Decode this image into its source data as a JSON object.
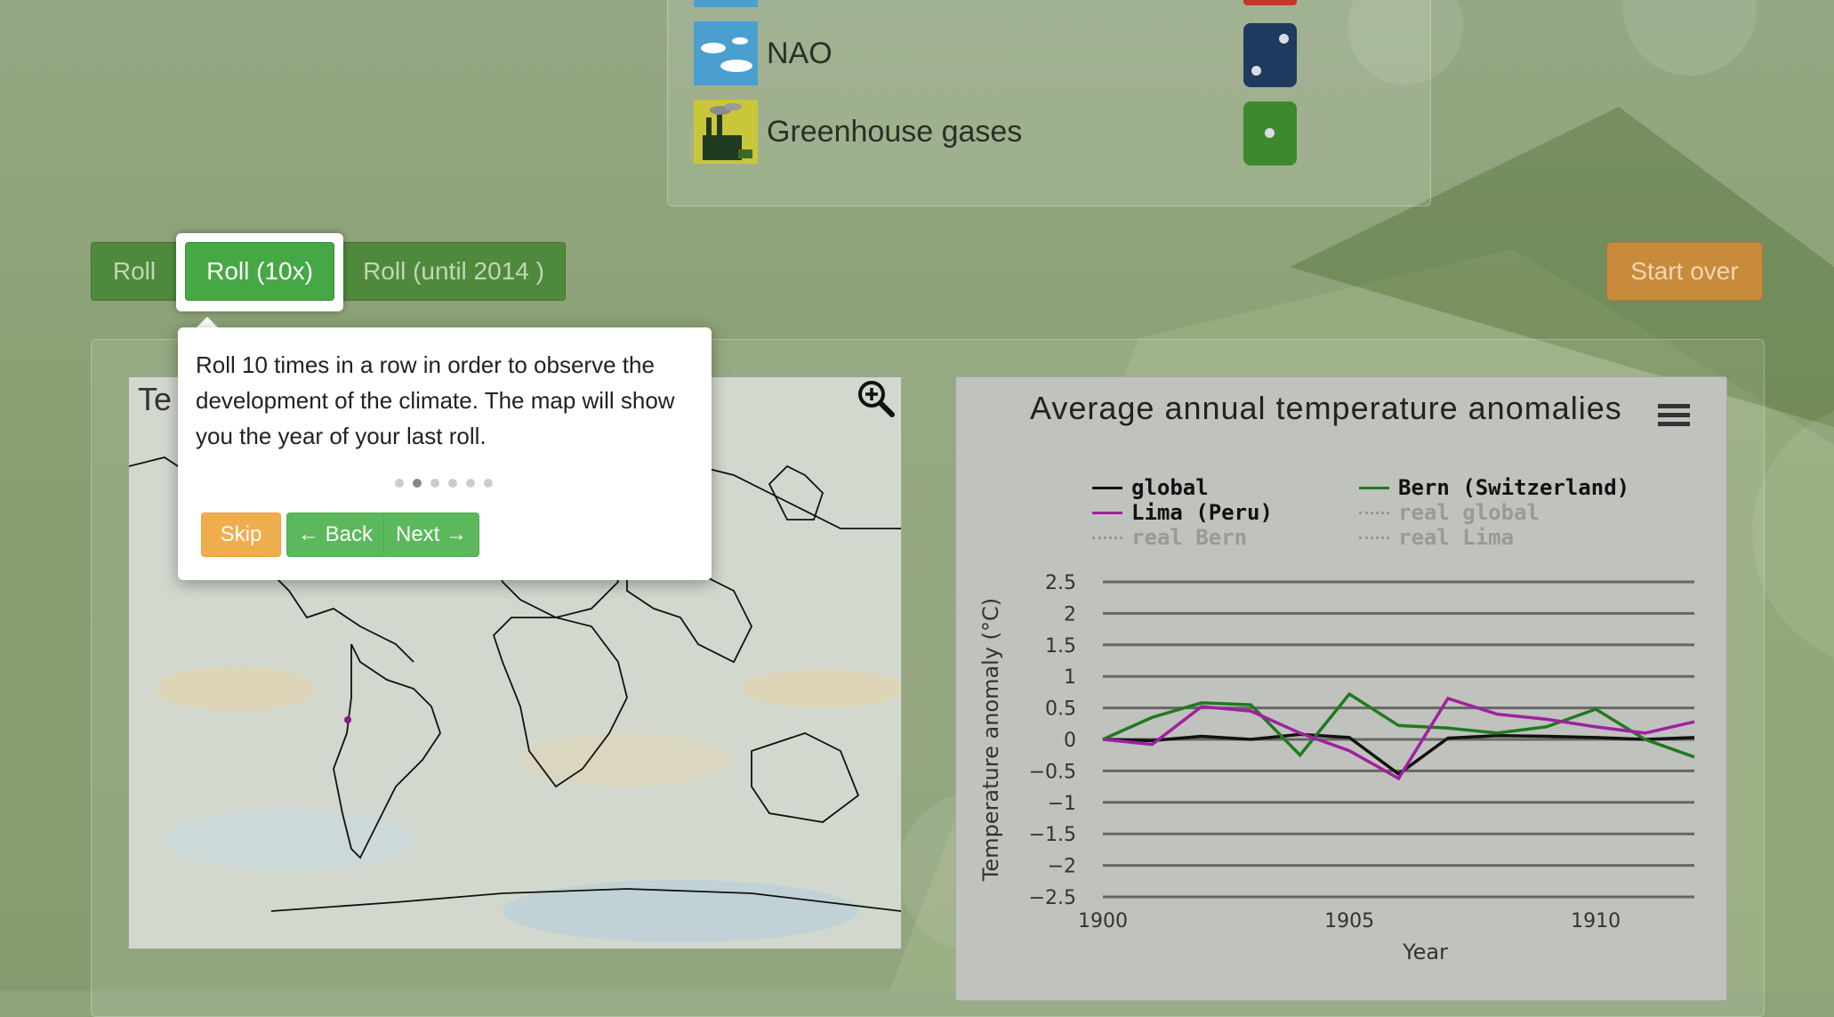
{
  "factors": [
    {
      "label": "NAO",
      "icon": "cloud-sky-icon",
      "die_color": "#1e3a5f",
      "die_value": 2
    },
    {
      "label": "Greenhouse gases",
      "icon": "factory-smoke-icon",
      "die_color": "#3d8a2e",
      "die_value": 1
    }
  ],
  "buttons": {
    "roll": "Roll",
    "roll10": "Roll (10x)",
    "roll_until": "Roll (until 2014 )",
    "start_over": "Start over"
  },
  "map": {
    "title": "Te",
    "zoom_icon": "zoom-in-icon"
  },
  "tour": {
    "text": "Roll 10 times in a row in order to observe the development of the climate. The map will show you the year of your last roll.",
    "steps_total": 6,
    "step_active": 2,
    "skip": "Skip",
    "back": "← Back",
    "next": "Next →"
  },
  "chart_data": {
    "type": "line",
    "title": "Average annual temperature anomalies",
    "xlabel": "Year",
    "ylabel": "Temperature anomaly (°C)",
    "xlim": [
      1900,
      1912
    ],
    "ylim": [
      -2.5,
      2.5
    ],
    "xticks": [
      "1900",
      "1905",
      "1910"
    ],
    "yticks": [
      "2.5",
      "2",
      "1.5",
      "1",
      "0.5",
      "0",
      "−0.5",
      "−1",
      "−1.5",
      "−2",
      "−2.5"
    ],
    "legend": [
      {
        "name": "global",
        "color": "#111111",
        "style": "solid",
        "visible": true
      },
      {
        "name": "Bern (Switzerland)",
        "color": "#1f7a1f",
        "style": "solid",
        "visible": true
      },
      {
        "name": "Lima (Peru)",
        "color": "#a020a0",
        "style": "solid",
        "visible": true
      },
      {
        "name": "real global",
        "color": "#999999",
        "style": "dotted",
        "visible": false
      },
      {
        "name": "real Bern",
        "color": "#999999",
        "style": "dotted",
        "visible": false
      },
      {
        "name": "real Lima",
        "color": "#999999",
        "style": "dotted",
        "visible": false
      }
    ],
    "series": [
      {
        "name": "global",
        "color": "#111111",
        "x": [
          1900,
          1901,
          1902,
          1903,
          1904,
          1905,
          1906,
          1907,
          1908,
          1909,
          1910,
          1911,
          1912
        ],
        "y": [
          0,
          -0.02,
          0.05,
          0,
          0.08,
          0.03,
          -0.55,
          0.02,
          0.06,
          0.05,
          0.03,
          0,
          0.03
        ]
      },
      {
        "name": "Bern (Switzerland)",
        "color": "#1f7a1f",
        "x": [
          1900,
          1901,
          1902,
          1903,
          1904,
          1905,
          1906,
          1907,
          1908,
          1909,
          1910,
          1911,
          1912
        ],
        "y": [
          0,
          0.35,
          0.58,
          0.55,
          -0.25,
          0.72,
          0.22,
          0.18,
          0.1,
          0.2,
          0.48,
          0,
          -0.28
        ]
      },
      {
        "name": "Lima (Peru)",
        "color": "#a020a0",
        "x": [
          1900,
          1901,
          1902,
          1903,
          1904,
          1905,
          1906,
          1907,
          1908,
          1909,
          1910,
          1911,
          1912
        ],
        "y": [
          0,
          -0.08,
          0.52,
          0.45,
          0.1,
          -0.18,
          -0.62,
          0.65,
          0.4,
          0.32,
          0.2,
          0.1,
          0.28
        ]
      }
    ]
  }
}
